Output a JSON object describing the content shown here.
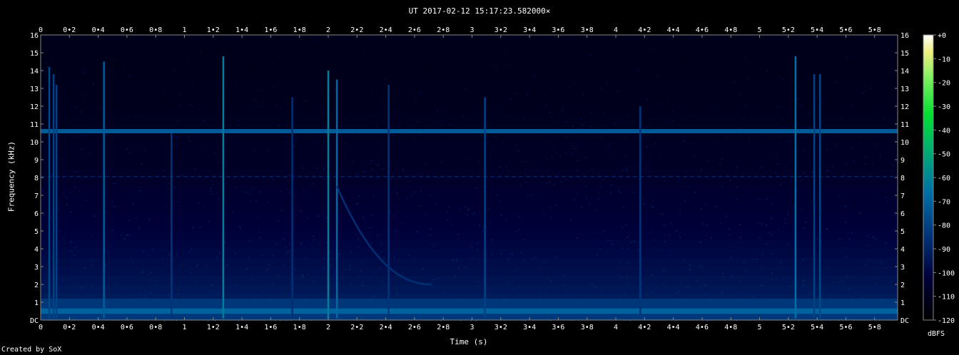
{
  "chart_data": {
    "type": "heatmap",
    "title": "UT 2017-02-12 15:17:23.582000×",
    "xlabel": "Time (s)",
    "ylabel": "Frequency (kHz)",
    "xlim": [
      0,
      5.96
    ],
    "ylim": [
      0,
      16
    ],
    "x_ticks": [
      "0",
      "0•2",
      "0•4",
      "0•6",
      "0•8",
      "1",
      "1•2",
      "1•4",
      "1•6",
      "1•8",
      "2",
      "2•2",
      "2•4",
      "2•6",
      "2•8",
      "3",
      "3•2",
      "3•4",
      "3•6",
      "3•8",
      "4",
      "4•2",
      "4•4",
      "4•6",
      "4•8",
      "5",
      "5•2",
      "5•4",
      "5•6",
      "5•8"
    ],
    "y_ticks": [
      "DC",
      "1",
      "2",
      "3",
      "4",
      "5",
      "6",
      "7",
      "8",
      "9",
      "10",
      "11",
      "12",
      "13",
      "14",
      "15",
      "16"
    ],
    "colorbar": {
      "label": "dBFS",
      "range": [
        -120,
        0
      ],
      "ticks": [
        "+0",
        "-10",
        "-20",
        "-30",
        "-40",
        "-50",
        "-60",
        "-70",
        "-80",
        "-90",
        "-100",
        "-110",
        "-120"
      ]
    },
    "features": {
      "tone_khz": 10.6,
      "tone_level_dbfs": -72,
      "low_band_khz": [
        0,
        1.2
      ],
      "impulses": [
        {
          "t": 0.06,
          "fmax": 14.2,
          "level": -78
        },
        {
          "t": 0.09,
          "fmax": 13.8,
          "level": -80
        },
        {
          "t": 0.11,
          "fmax": 13.2,
          "level": -80
        },
        {
          "t": 0.44,
          "fmax": 14.5,
          "level": -72
        },
        {
          "t": 0.91,
          "fmax": 10.5,
          "level": -84
        },
        {
          "t": 1.27,
          "fmax": 14.8,
          "level": -62
        },
        {
          "t": 1.75,
          "fmax": 12.5,
          "level": -86
        },
        {
          "t": 2.0,
          "fmax": 14.0,
          "level": -62
        },
        {
          "t": 2.06,
          "fmax": 13.5,
          "level": -68
        },
        {
          "t": 2.42,
          "fmax": 13.2,
          "level": -84
        },
        {
          "t": 3.09,
          "fmax": 12.5,
          "level": -80
        },
        {
          "t": 4.17,
          "fmax": 12.0,
          "level": -84
        },
        {
          "t": 5.25,
          "fmax": 14.8,
          "level": -66
        },
        {
          "t": 5.38,
          "fmax": 13.8,
          "level": -80
        },
        {
          "t": 5.42,
          "fmax": 13.8,
          "level": -78
        }
      ],
      "chirp": {
        "t_start": 2.06,
        "t_end": 2.72,
        "f_start_khz": 7.5,
        "f_end_khz": 2.0,
        "level": -86
      }
    },
    "grid": false,
    "colors": {
      "low": "#00003a",
      "mid": "#0060a0",
      "high": "#00e070",
      "top": "#ffffff"
    }
  }
}
